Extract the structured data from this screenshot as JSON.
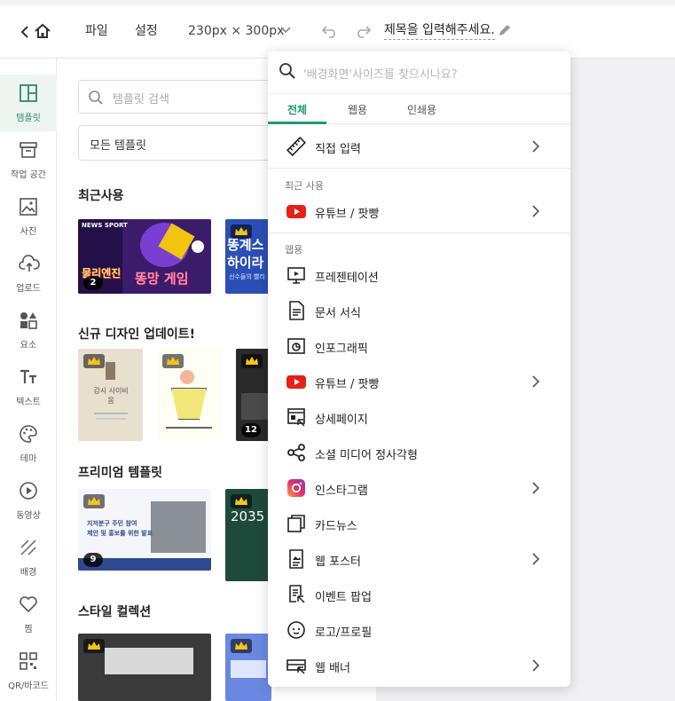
{
  "topbar": {
    "file_label": "파일",
    "settings_label": "설정",
    "size_label": "230px × 300px",
    "title_placeholder": "제목을 입력해주세요."
  },
  "leftnav": {
    "items": [
      {
        "label": "템플릿",
        "icon": "layout-icon",
        "active": true
      },
      {
        "label": "작업 공간",
        "icon": "archive-icon"
      },
      {
        "label": "사진",
        "icon": "image-icon"
      },
      {
        "label": "업로드",
        "icon": "upload-cloud-icon"
      },
      {
        "label": "요소",
        "icon": "shapes-icon"
      },
      {
        "label": "텍스트",
        "icon": "text-icon"
      },
      {
        "label": "테마",
        "icon": "palette-icon"
      },
      {
        "label": "동영상",
        "icon": "play-circle-icon"
      },
      {
        "label": "배경",
        "icon": "background-icon"
      },
      {
        "label": "찜",
        "icon": "heart-icon"
      },
      {
        "label": "QR/바코드",
        "icon": "qr-icon"
      }
    ]
  },
  "panel": {
    "search_placeholder": "템플릿 검색",
    "select_value": "모든 템플릿",
    "sections": [
      {
        "title": "최근사용"
      },
      {
        "title": "신규 디자인 업데이트!"
      },
      {
        "title": "프리미엄 템플릿"
      },
      {
        "title": "스타일 컬렉션"
      }
    ],
    "thumb_texts": {
      "game_top": "NEWS SPORT",
      "game_line1": "물리엔진",
      "game_line2": "똥망 게임",
      "game_count": "2",
      "sport_line1": "똥계스",
      "sport_line2": "하이라",
      "sport_sub": "선수들의 빨리",
      "book_title": "감시 사이비 몸",
      "new_count": "12",
      "premium_title1": "지저분구 주민 참여",
      "premium_title2": "제안 및 홍보를 위한 발표",
      "premium_count": "9",
      "green_year": "2035"
    }
  },
  "dropdown": {
    "search_placeholder": "'배경화면'사이즈를 찾으시나요?",
    "tabs": [
      "전체",
      "웹용",
      "인쇄용"
    ],
    "direct_input": "직접 입력",
    "recent_label": "최근 사용",
    "recent_item": "유튜브 / 팟빵",
    "web_label": "웹용",
    "web_items": [
      {
        "label": "프레젠테이션",
        "icon": "presentation-icon",
        "chevron": false
      },
      {
        "label": "문서 서식",
        "icon": "document-icon",
        "chevron": false
      },
      {
        "label": "인포그래픽",
        "icon": "infographic-icon",
        "chevron": false
      },
      {
        "label": "유튜브 / 팟빵",
        "icon": "youtube-icon",
        "chevron": true
      },
      {
        "label": "상세페이지",
        "icon": "detail-page-icon",
        "chevron": false
      },
      {
        "label": "소셜 미디어 정사각형",
        "icon": "share-icon",
        "chevron": false
      },
      {
        "label": "인스타그램",
        "icon": "instagram-icon",
        "chevron": true
      },
      {
        "label": "카드뉴스",
        "icon": "card-news-icon",
        "chevron": false
      },
      {
        "label": "웹 포스터",
        "icon": "web-poster-icon",
        "chevron": true
      },
      {
        "label": "이벤트 팝업",
        "icon": "event-popup-icon",
        "chevron": false
      },
      {
        "label": "로고/프로필",
        "icon": "smile-icon",
        "chevron": false
      },
      {
        "label": "웹 배너",
        "icon": "web-banner-icon",
        "chevron": true
      }
    ]
  },
  "colors": {
    "accent": "#1a9b6b",
    "youtube": "#e62117"
  }
}
